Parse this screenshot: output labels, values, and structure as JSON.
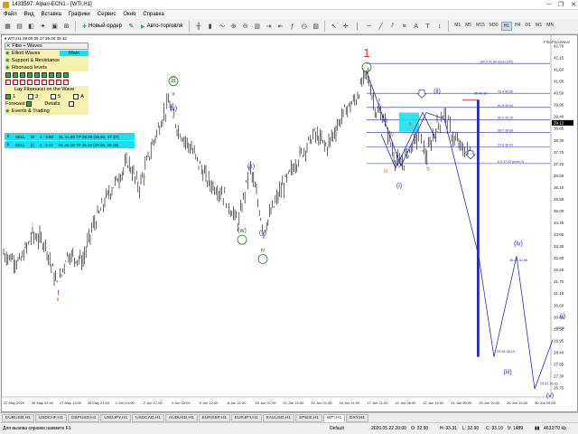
{
  "window": {
    "title": "1433597: Alpari-ECN1 - [WTI,H1]",
    "controls": [
      "–",
      "❐",
      "✕"
    ]
  },
  "menu": [
    "Файл",
    "Вид",
    "Вставка",
    "Графики",
    "Сервис",
    "Окно",
    "Справка"
  ],
  "toolbar": {
    "new_order": "Новый ордер",
    "auto_trading": "Авто-торговля",
    "timeframes": [
      "M1",
      "M5",
      "M15",
      "M30",
      "H1",
      "H4",
      "D1",
      "W1",
      "MN"
    ],
    "active_timeframe": "H1"
  },
  "chart": {
    "caption": "WTI,H1 39.00 39.17 39.00 39.12",
    "indicator_label": "FiboPlusWave",
    "panel": {
      "title": "Fibo + Waves",
      "items": [
        "Elliott Waves",
        "Support & Resistance",
        "Fibonacci levels"
      ],
      "main_label": "Main",
      "lay_fib": "Lay Fibonacci on the Wave",
      "checks": [
        "1",
        "3",
        "5",
        "A"
      ],
      "forecast": "Forecast",
      "details": "Details",
      "events": "Events & Trading"
    },
    "signals": [
      {
        "side": "SELL",
        "lot": "W",
        "ratio": "1 : 3.50",
        "sl": "SL 41.89 TP 29.38 (25.61, 17.37)"
      },
      {
        "side": "SELL",
        "lot": "(i)",
        "ratio": "1 : 3.42",
        "sl": "SL 40.18 TP 35.42 (32.66, 28.19)"
      }
    ],
    "wave_labels": [
      {
        "text": "1",
        "color": "#e03030"
      },
      {
        "text": "iii",
        "color": "#1f7a1f"
      },
      {
        "text": "v",
        "color": "#1f7a1f"
      },
      {
        "text": "(v)",
        "color": "#2a2ab8"
      },
      {
        "text": "v",
        "color": "#d2691e"
      },
      {
        "text": "iii",
        "color": "#d2691e"
      },
      {
        "text": "iv",
        "color": "#d2691e"
      },
      {
        "text": "i",
        "color": "#d2691e"
      },
      {
        "text": "ii",
        "color": "#d2691e"
      },
      {
        "text": "(x)",
        "color": "#2a2ab8"
      },
      {
        "text": "(w)",
        "color": "#1f7a1f"
      },
      {
        "text": "(y)",
        "color": "#2a2ab8"
      },
      {
        "text": "iv",
        "color": "#1f7a1f"
      },
      {
        "text": "ii",
        "color": "#d2691e"
      },
      {
        "text": "(ii)",
        "color": "#2a2ab8"
      },
      {
        "text": "a",
        "color": "#d2691e"
      },
      {
        "text": "c",
        "color": "#d2691e"
      },
      {
        "text": "b",
        "color": "#d2691e"
      },
      {
        "text": "iii",
        "color": "#d2691e"
      },
      {
        "text": "v",
        "color": "#d2691e"
      },
      {
        "text": "(i)",
        "color": "#2a2ab8"
      },
      {
        "text": "iv",
        "color": "#d2691e"
      },
      {
        "text": "(iv)",
        "color": "#2a2ab8"
      },
      {
        "text": "(iii)",
        "color": "#2a2ab8"
      },
      {
        "text": "(v)",
        "color": "#2a2ab8"
      },
      {
        "text": "(i)",
        "color": "#2a2ab8"
      }
    ],
    "fib_levels": [
      {
        "label": "100.0  41.89 (level 100)",
        "price": 41.89
      },
      {
        "label": "76.4  40.50",
        "price": 40.5
      },
      {
        "label": "61.8  39.84",
        "price": 39.84
      },
      {
        "label": "50.0  39.26",
        "price": 39.26
      },
      {
        "label": "38.2  38.68",
        "price": 38.68
      },
      {
        "label": "23.6  38.00",
        "price": 38.0
      },
      {
        "label": "0.0  37.22 (level 0)",
        "price": 37.22
      }
    ],
    "projection_labels": [
      {
        "text": "35.40.18"
      },
      {
        "text": "36.23 32.66"
      },
      {
        "text": "29.38 28.19"
      },
      {
        "text": "25.61 26.81"
      },
      {
        "text": "29.38"
      }
    ],
    "price_axis": [
      "42.70",
      "42.15",
      "41.60",
      "41.05",
      "40.50",
      "39.95",
      "39.40",
      "38.85",
      "38.30",
      "37.75",
      "37.20",
      "36.65",
      "36.10",
      "35.55",
      "35.00",
      "34.45",
      "33.90",
      "33.35",
      "32.80",
      "32.25",
      "31.70",
      "31.15",
      "30.60",
      "30.05",
      "29.50",
      "28.95",
      "28.40",
      "27.85",
      "27.30",
      "26.75"
    ],
    "current_price": "39.12",
    "time_axis": [
      "22 May 2020",
      "26 May 04:00",
      "27 May 13:00",
      "28 May 21:00",
      "1 Jun 14:00",
      "2 Jun 17:00",
      "4 Jun 03:00",
      "5 Jun 12:00",
      "8 Jun 21:00",
      "10 Jun 07:00",
      "11 Jun 15:00",
      "15 Jun 01:00",
      "16 Jun 11:00",
      "17 Jun 21:00",
      "19 Jun 06:00",
      "22 Jun 15:00",
      "24 Jun 00:00",
      "25 Jun 10:00",
      "26 Jun 19:00",
      "30 Jun 05:00"
    ]
  },
  "tabs": [
    "EURUSD,H1",
    "USDCHF,H1",
    "GBPUSD,H1",
    "USDJPY,H1",
    "USDCAD,H1",
    "AUDUSD,H1",
    "EURGBP,H1",
    "EURJPY,H1",
    "XAUUSD,H1",
    "SP500,H1",
    "WTI,H1",
    "DXY,H1"
  ],
  "active_tab": "WTI,H1",
  "status": {
    "hint": "Для вызова справки нажмите F1",
    "profile": "Default",
    "datetime": "2020.05.22 20:00",
    "open": "O: 32.90",
    "high": "H: 33.31",
    "low": "L: 32.90",
    "close": "C: 33.10",
    "volume": "V: 1489",
    "traffic": "4632/70 kb"
  },
  "colors": {
    "bull": "#1f7a1f",
    "bear": "#2a2ab8",
    "sub": "#d2691e",
    "impulse": "#e03030",
    "fib": "#2a2ab8",
    "signal": "#19e0f0"
  }
}
